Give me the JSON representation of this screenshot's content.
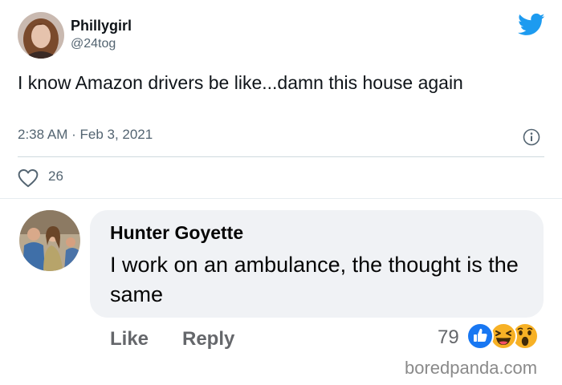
{
  "tweet": {
    "author_name": "Phillygirl",
    "author_handle": "@24tog",
    "text": "I know Amazon drivers be like...damn this house again",
    "timestamp": "2:38 AM · Feb 3, 2021",
    "like_count": "26",
    "icons": [
      "twitter-bird-icon",
      "info-icon",
      "heart-icon"
    ],
    "colors": {
      "brand": "#1d9bf0",
      "secondary_text": "#536471",
      "divider": "#cfd9de"
    }
  },
  "comment": {
    "author_name": "Hunter Goyette",
    "text": "I work on an ambulance, the thought is the same",
    "like_label": "Like",
    "reply_label": "Reply",
    "reaction_count": "79",
    "reactions": [
      "like-reaction-icon",
      "haha-reaction-icon",
      "wow-reaction-icon"
    ],
    "colors": {
      "bubble": "#f0f2f5",
      "action_text": "#65676b",
      "like_blue": "#1877f2",
      "reaction_yellow": "#f7b125"
    }
  },
  "watermark": "boredpanda.com"
}
